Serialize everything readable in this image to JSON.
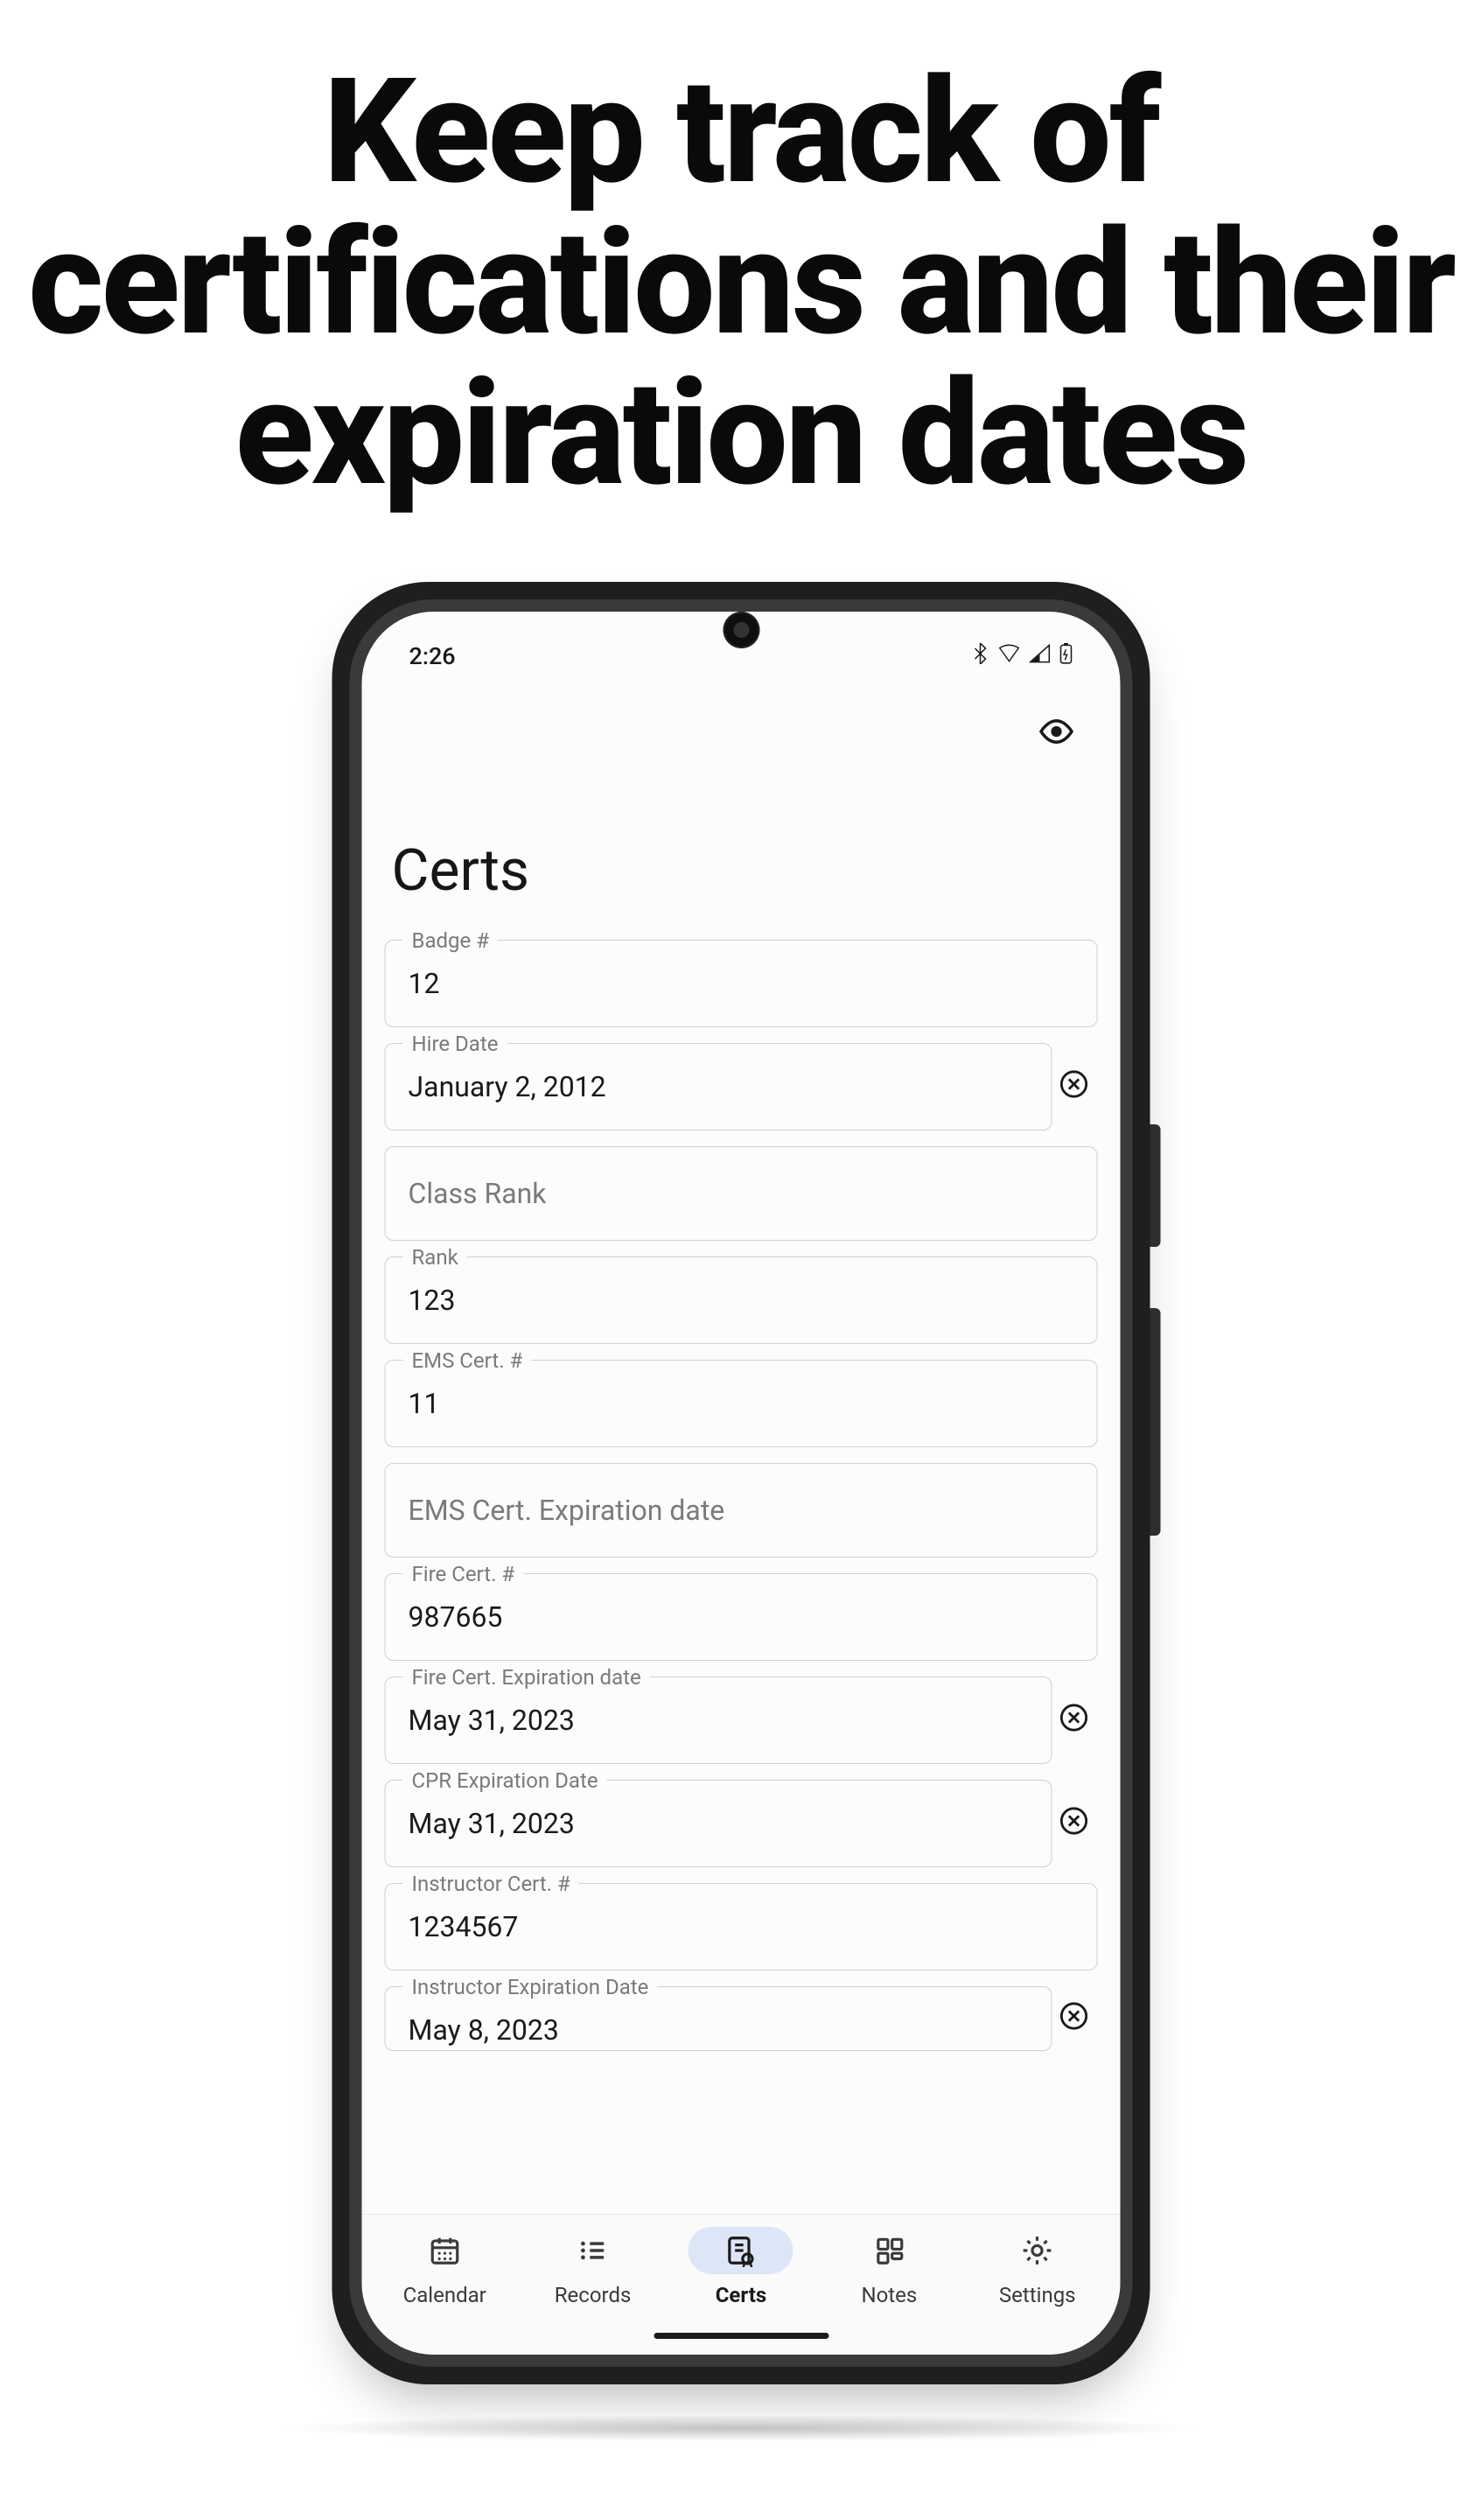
{
  "headline": "Keep track of certifications and their expiration dates",
  "status": {
    "time": "2:26"
  },
  "page": {
    "title": "Certs"
  },
  "fields": {
    "badge": {
      "label": "Badge #",
      "value": "12"
    },
    "hire": {
      "label": "Hire Date",
      "value": "January 2, 2012"
    },
    "classrank": {
      "placeholder": "Class Rank"
    },
    "rank": {
      "label": "Rank",
      "value": "123"
    },
    "emsnum": {
      "label": "EMS Cert. #",
      "value": "11"
    },
    "emsexp": {
      "placeholder": "EMS Cert. Expiration date"
    },
    "firenum": {
      "label": "Fire Cert. #",
      "value": "987665"
    },
    "fireexp": {
      "label": "Fire Cert. Expiration date",
      "value": "May 31, 2023"
    },
    "cprexp": {
      "label": "CPR Expiration Date",
      "value": "May 31, 2023"
    },
    "instrnum": {
      "label": "Instructor Cert. #",
      "value": "1234567"
    },
    "instrexp": {
      "label": "Instructor Expiration Date",
      "value": "May 8, 2023"
    }
  },
  "nav": {
    "calendar": "Calendar",
    "records": "Records",
    "certs": "Certs",
    "notes": "Notes",
    "settings": "Settings"
  }
}
